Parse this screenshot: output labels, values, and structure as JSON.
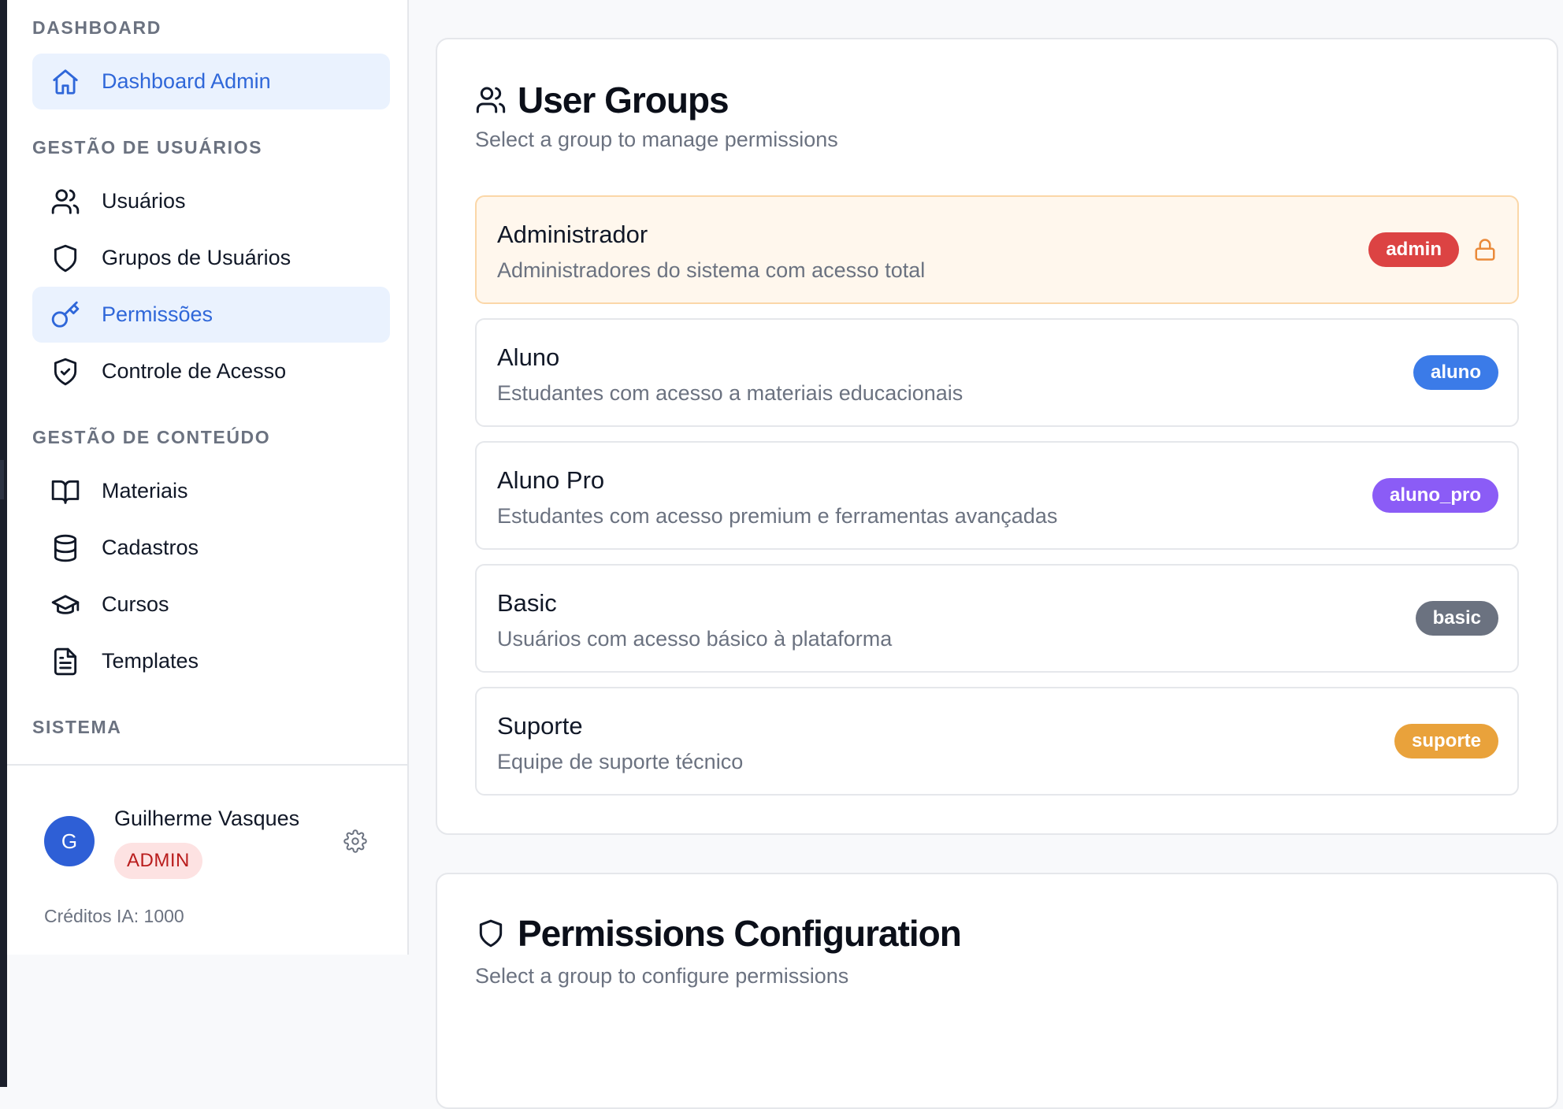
{
  "sidebar": {
    "sections": {
      "dashboard": "DASHBOARD",
      "users": "GESTÃO DE USUÁRIOS",
      "content": "GESTÃO DE CONTEÚDO",
      "system": "SISTEMA"
    },
    "items": [
      {
        "label": "Dashboard Admin",
        "icon": "home-icon",
        "active": true
      },
      {
        "label": "Usuários",
        "icon": "users-icon",
        "active": false
      },
      {
        "label": "Grupos de Usuários",
        "icon": "shield-icon",
        "active": false
      },
      {
        "label": "Permissões",
        "icon": "key-icon",
        "active": true
      },
      {
        "label": "Controle de Acesso",
        "icon": "shield-check-icon",
        "active": false
      },
      {
        "label": "Materiais",
        "icon": "book-open-icon",
        "active": false
      },
      {
        "label": "Cadastros",
        "icon": "database-icon",
        "active": false
      },
      {
        "label": "Cursos",
        "icon": "graduation-cap-icon",
        "active": false
      },
      {
        "label": "Templates",
        "icon": "file-text-icon",
        "active": false
      }
    ],
    "user": {
      "initial": "G",
      "name": "Guilherme Vasques",
      "role": "ADMIN",
      "credits": "Créditos IA: 1000"
    }
  },
  "user_groups": {
    "title": "User Groups",
    "subtitle": "Select a group to manage permissions",
    "groups": [
      {
        "name": "Administrador",
        "description": "Administradores do sistema com acesso total",
        "tag": "admin",
        "tag_color": "#dc4343",
        "locked": true,
        "selected": true
      },
      {
        "name": "Aluno",
        "description": "Estudantes com acesso a materiais educacionais",
        "tag": "aluno",
        "tag_color": "#3b7be8",
        "locked": false,
        "selected": false
      },
      {
        "name": "Aluno Pro",
        "description": "Estudantes com acesso premium e ferramentas avançadas",
        "tag": "aluno_pro",
        "tag_color": "#8b5cf6",
        "locked": false,
        "selected": false
      },
      {
        "name": "Basic",
        "description": "Usuários com acesso básico à plataforma",
        "tag": "basic",
        "tag_color": "#6b7280",
        "locked": false,
        "selected": false
      },
      {
        "name": "Suporte",
        "description": "Equipe de suporte técnico",
        "tag": "suporte",
        "tag_color": "#e9a23b",
        "locked": false,
        "selected": false
      }
    ]
  },
  "permissions": {
    "title": "Permissions Configuration",
    "subtitle": "Select a group to configure permissions"
  },
  "colors": {
    "accent": "#2f67d9",
    "active_bg": "#eaf2fe",
    "selected_group_bg": "#fff7ed",
    "lock": "#ea8a3a"
  }
}
